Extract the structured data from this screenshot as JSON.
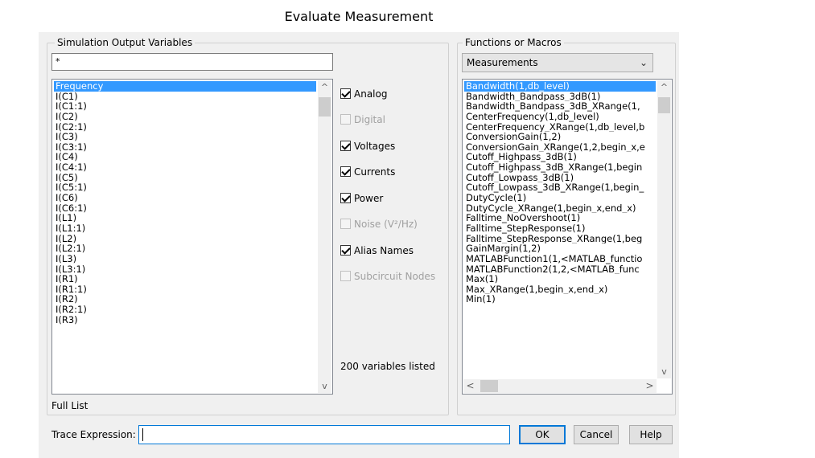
{
  "dialog": {
    "title": "Evaluate Measurement"
  },
  "sim_output": {
    "legend": "Simulation Output Variables",
    "filter_value": "*",
    "variables": [
      "Frequency",
      "I(C1)",
      "I(C1:1)",
      "I(C2)",
      "I(C2:1)",
      "I(C3)",
      "I(C3:1)",
      "I(C4)",
      "I(C4:1)",
      "I(C5)",
      "I(C5:1)",
      "I(C6)",
      "I(C6:1)",
      "I(L1)",
      "I(L1:1)",
      "I(L2)",
      "I(L2:1)",
      "I(L3)",
      "I(L3:1)",
      "I(R1)",
      "I(R1:1)",
      "I(R2)",
      "I(R2:1)",
      "I(R3)"
    ],
    "selected_index": 0,
    "list_mode": "Full List",
    "count_text": "200 variables listed"
  },
  "filters": [
    {
      "label": "Analog",
      "checked": true,
      "enabled": true
    },
    {
      "label": "Digital",
      "checked": false,
      "enabled": false
    },
    {
      "label": "Voltages",
      "checked": true,
      "enabled": true
    },
    {
      "label": "Currents",
      "checked": true,
      "enabled": true
    },
    {
      "label": "Power",
      "checked": true,
      "enabled": true
    },
    {
      "label": "Noise (V²/Hz)",
      "checked": false,
      "enabled": false
    },
    {
      "label": "Alias Names",
      "checked": true,
      "enabled": true
    },
    {
      "label": "Subcircuit Nodes",
      "checked": false,
      "enabled": false
    }
  ],
  "functions": {
    "legend": "Functions or Macros",
    "category": "Measurements",
    "items": [
      "Bandwidth(1,db_level)",
      "Bandwidth_Bandpass_3dB(1)",
      "Bandwidth_Bandpass_3dB_XRange(1,",
      "CenterFrequency(1,db_level)",
      "CenterFrequency_XRange(1,db_level,b",
      "ConversionGain(1,2)",
      "ConversionGain_XRange(1,2,begin_x,e",
      "Cutoff_Highpass_3dB(1)",
      "Cutoff_Highpass_3dB_XRange(1,begin",
      "Cutoff_Lowpass_3dB(1)",
      "Cutoff_Lowpass_3dB_XRange(1,begin_",
      "DutyCycle(1)",
      "DutyCycle_XRange(1,begin_x,end_x)",
      "Falltime_NoOvershoot(1)",
      "Falltime_StepResponse(1)",
      "Falltime_StepResponse_XRange(1,beg",
      "GainMargin(1,2)",
      "MATLABFunction1(1,<MATLAB_functio",
      "MATLABFunction2(1,2,<MATLAB_func",
      "Max(1)",
      "Max_XRange(1,begin_x,end_x)",
      "Min(1)"
    ],
    "selected_index": 0
  },
  "trace": {
    "label": "Trace Expression:",
    "value": ""
  },
  "buttons": {
    "ok": "OK",
    "cancel": "Cancel",
    "help": "Help"
  },
  "icons": {
    "up": "▲-arrow",
    "down": "▼-arrow",
    "left": "◀-arrow",
    "right": "▶-arrow",
    "combo": "chevron-down"
  },
  "colors": {
    "selection": "#3399ff",
    "dialog_bg": "#f0f0f0",
    "default_button_border": "#0078d7"
  }
}
